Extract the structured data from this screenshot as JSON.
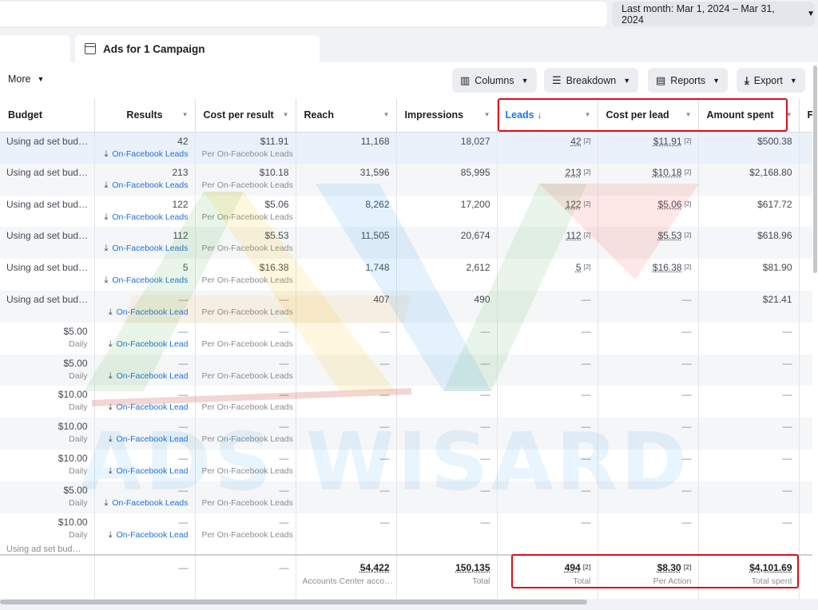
{
  "date_range": "Last month: Mar 1, 2024 – Mar 31, 2024",
  "tab_title": "Ads for 1 Campaign",
  "toolbar": {
    "more": "More",
    "columns": "Columns",
    "breakdown": "Breakdown",
    "reports": "Reports",
    "export": "Export"
  },
  "columns": [
    "Budget",
    "Results",
    "Cost per result",
    "Reach",
    "Impressions",
    "Leads ↓",
    "Cost per lead",
    "Amount spent",
    "Fo"
  ],
  "rows": [
    {
      "budget": "Using ad set bud…",
      "budget_sub": "",
      "results": "42",
      "results_sub": "On-Facebook Leads",
      "cpr": "$11.91",
      "cpr_sub": "Per On-Facebook Leads",
      "reach": "11,168",
      "impressions": "18,027",
      "leads": "42",
      "cpl": "$11.91",
      "spent": "$500.38"
    },
    {
      "budget": "Using ad set bud…",
      "budget_sub": "",
      "results": "213",
      "results_sub": "On-Facebook Leads",
      "cpr": "$10.18",
      "cpr_sub": "Per On-Facebook Leads",
      "reach": "31,596",
      "impressions": "85,995",
      "leads": "213",
      "cpl": "$10.18",
      "spent": "$2,168.80"
    },
    {
      "budget": "Using ad set bud…",
      "budget_sub": "",
      "results": "122",
      "results_sub": "On-Facebook Leads",
      "cpr": "$5.06",
      "cpr_sub": "Per On-Facebook Leads",
      "reach": "8,262",
      "impressions": "17,200",
      "leads": "122",
      "cpl": "$5.06",
      "spent": "$617.72"
    },
    {
      "budget": "Using ad set bud…",
      "budget_sub": "",
      "results": "112",
      "results_sub": "On-Facebook Leads",
      "cpr": "$5.53",
      "cpr_sub": "Per On-Facebook Leads",
      "reach": "11,505",
      "impressions": "20,674",
      "leads": "112",
      "cpl": "$5.53",
      "spent": "$618.96"
    },
    {
      "budget": "Using ad set bud…",
      "budget_sub": "",
      "results": "5",
      "results_sub": "On-Facebook Leads",
      "cpr": "$16.38",
      "cpr_sub": "Per On-Facebook Leads",
      "reach": "1,748",
      "impressions": "2,612",
      "leads": "5",
      "cpl": "$16.38",
      "spent": "$81.90"
    },
    {
      "budget": "Using ad set bud…",
      "budget_sub": "",
      "results": "—",
      "results_sub": "On-Facebook Lead",
      "cpr": "—",
      "cpr_sub": "Per On-Facebook Leads",
      "reach": "407",
      "impressions": "490",
      "leads": "—",
      "cpl": "—",
      "spent": "$21.41"
    },
    {
      "budget": "$5.00",
      "budget_sub": "Daily",
      "results": "—",
      "results_sub": "On-Facebook Lead",
      "cpr": "—",
      "cpr_sub": "Per On-Facebook Leads",
      "reach": "—",
      "impressions": "—",
      "leads": "—",
      "cpl": "—",
      "spent": "—"
    },
    {
      "budget": "$5.00",
      "budget_sub": "Daily",
      "results": "—",
      "results_sub": "On-Facebook Lead",
      "cpr": "—",
      "cpr_sub": "Per On-Facebook Leads",
      "reach": "—",
      "impressions": "—",
      "leads": "—",
      "cpl": "—",
      "spent": "—"
    },
    {
      "budget": "$10.00",
      "budget_sub": "Daily",
      "results": "—",
      "results_sub": "On-Facebook Lead",
      "cpr": "—",
      "cpr_sub": "Per On-Facebook Leads",
      "reach": "—",
      "impressions": "—",
      "leads": "—",
      "cpl": "—",
      "spent": "—"
    },
    {
      "budget": "$10.00",
      "budget_sub": "Daily",
      "results": "—",
      "results_sub": "On-Facebook Lead",
      "cpr": "—",
      "cpr_sub": "Per On-Facebook Leads",
      "reach": "—",
      "impressions": "—",
      "leads": "—",
      "cpl": "—",
      "spent": "—"
    },
    {
      "budget": "$10.00",
      "budget_sub": "Daily",
      "results": "—",
      "results_sub": "On-Facebook Lead",
      "cpr": "—",
      "cpr_sub": "Per On-Facebook Leads",
      "reach": "—",
      "impressions": "—",
      "leads": "—",
      "cpl": "—",
      "spent": "—"
    },
    {
      "budget": "$5.00",
      "budget_sub": "Daily",
      "results": "—",
      "results_sub": "On-Facebook Leads",
      "cpr": "—",
      "cpr_sub": "Per On-Facebook Leads",
      "reach": "—",
      "impressions": "—",
      "leads": "—",
      "cpl": "—",
      "spent": "—"
    },
    {
      "budget": "$10.00",
      "budget_sub": "Daily",
      "results": "—",
      "results_sub": "On-Facebook Lead",
      "cpr": "—",
      "cpr_sub": "Per On-Facebook Leads",
      "reach": "—",
      "impressions": "—",
      "leads": "—",
      "cpl": "—",
      "spent": "—"
    }
  ],
  "cut_row_text": "Using ad set bud…",
  "totals": {
    "budget": "",
    "results": "—",
    "cpr": "—",
    "reach": "54,422",
    "reach_sub": "Accounts Center acco…",
    "impressions": "150,135",
    "impressions_sub": "Total",
    "leads": "494",
    "leads_sub": "Total",
    "cpl": "$8.30",
    "cpl_sub": "Per Action",
    "spent": "$4,101.69",
    "spent_sub": "Total spent"
  },
  "footnote_marker": "[2]",
  "watermark": {
    "text": "ADS WISARD"
  },
  "colors": {
    "accent": "#1877f2",
    "highlight_box": "#d9101a",
    "row_highlight": "#eaf1fb",
    "link": "#216fdb"
  },
  "icons": [
    "columns-icon",
    "breakdown-icon",
    "reports-icon",
    "export-icon",
    "download-icon",
    "sort-down-icon",
    "caret-down-icon",
    "tab-icon"
  ]
}
